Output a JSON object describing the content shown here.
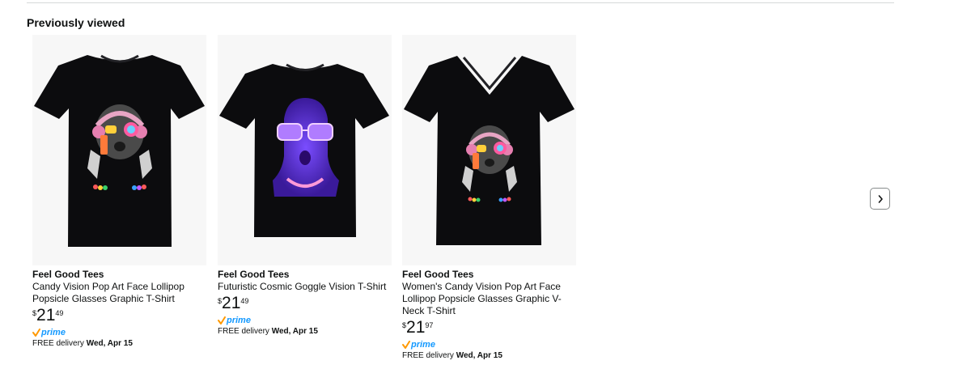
{
  "section": {
    "title": "Previously viewed"
  },
  "nav": {
    "prev_icon": "chevron-left-icon",
    "next_icon": "chevron-right-icon"
  },
  "prime_label": "prime",
  "colors": {
    "prime_blue": "#1399ff",
    "prime_check": "#ff9900",
    "shirt": "#0c0c0e",
    "cosmic_glow": "#5b2bd8"
  },
  "products": [
    {
      "brand": "Feel Good Tees",
      "title": "Candy Vision Pop Art Face Lollipop Popsicle Glasses Graphic T-Shirt",
      "price_symbol": "$",
      "price_whole": "21",
      "price_fraction": "49",
      "delivery_prefix": "FREE delivery",
      "delivery_date": "Wed, Apr 15",
      "image_icon": "candy-vision-tshirt-image"
    },
    {
      "brand": "Feel Good Tees",
      "title": "Futuristic Cosmic Goggle Vision T-Shirt",
      "price_symbol": "$",
      "price_whole": "21",
      "price_fraction": "49",
      "delivery_prefix": "FREE delivery",
      "delivery_date": "Wed, Apr 15",
      "image_icon": "cosmic-goggle-tshirt-image"
    },
    {
      "brand": "Feel Good Tees",
      "title": "Women's Candy Vision Pop Art Face Lollipop Popsicle Glasses Graphic V-Neck T-Shirt",
      "price_symbol": "$",
      "price_whole": "21",
      "price_fraction": "97",
      "delivery_prefix": "FREE delivery",
      "delivery_date": "Wed, Apr 15",
      "image_icon": "candy-vision-vneck-image"
    }
  ]
}
